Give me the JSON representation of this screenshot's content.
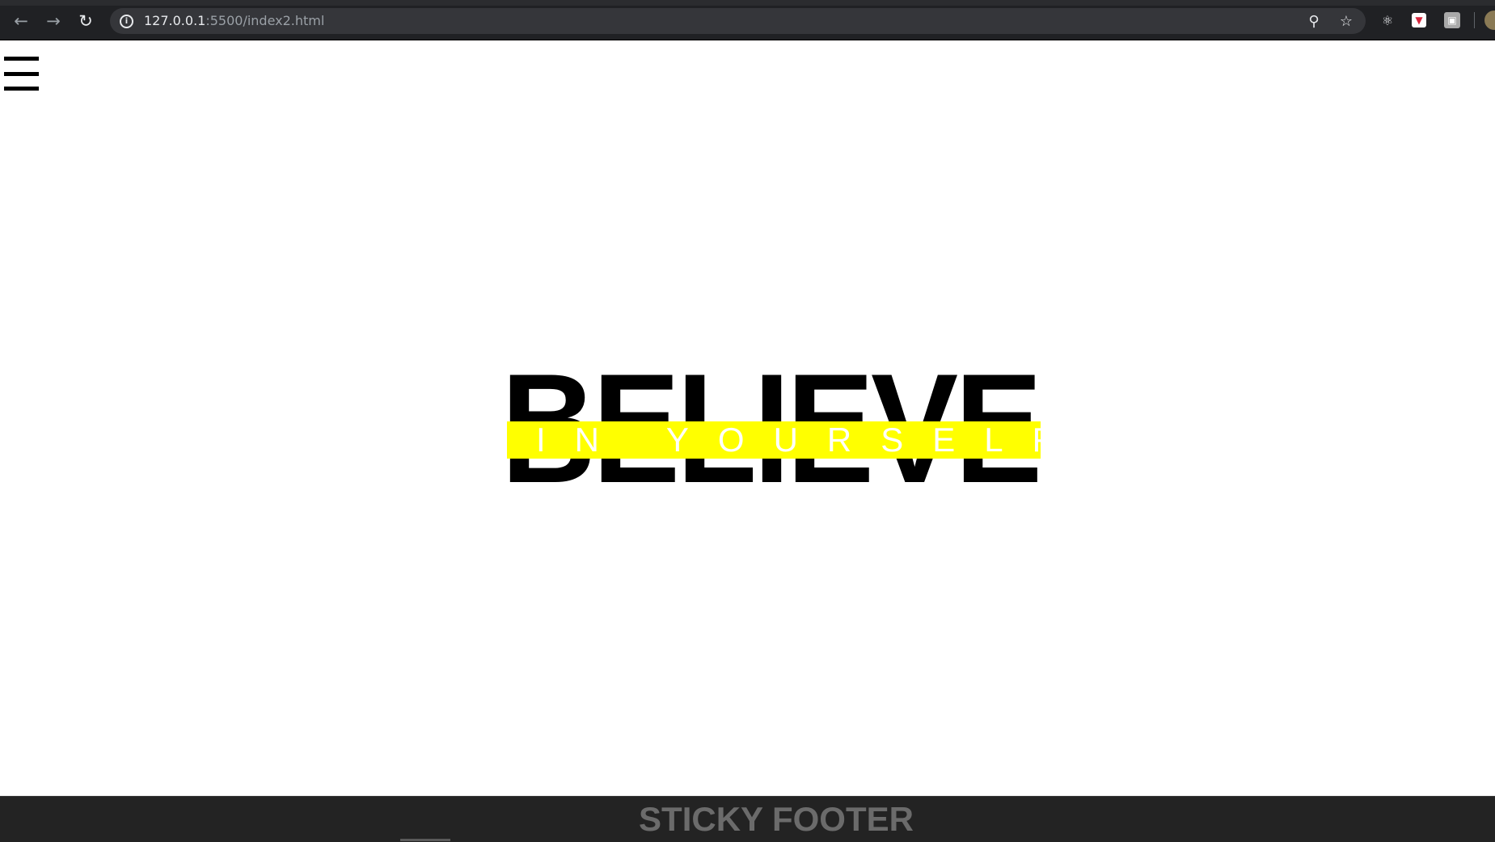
{
  "browser": {
    "url_host": "127.0.0.1",
    "url_rest": ":5500/index2.html"
  },
  "hero": {
    "headline": "BELIEVE",
    "tagline": "IN YOURSELF"
  },
  "footer": {
    "label": "STICKY FOOTER"
  },
  "icons": {
    "back": "back-arrow-icon",
    "forward": "forward-arrow-icon",
    "reload": "reload-icon",
    "info": "site-info-icon",
    "zoom": "zoom-icon",
    "star": "bookmark-star-icon",
    "react": "react-extension-icon",
    "pocket": "pocket-extension-icon",
    "extension": "extension-icon",
    "profile": "profile-avatar",
    "menu": "hamburger-menu-icon"
  },
  "colors": {
    "band": "#ffff00",
    "footer_bg": "#232323",
    "footer_text": "#6b6b6b"
  }
}
